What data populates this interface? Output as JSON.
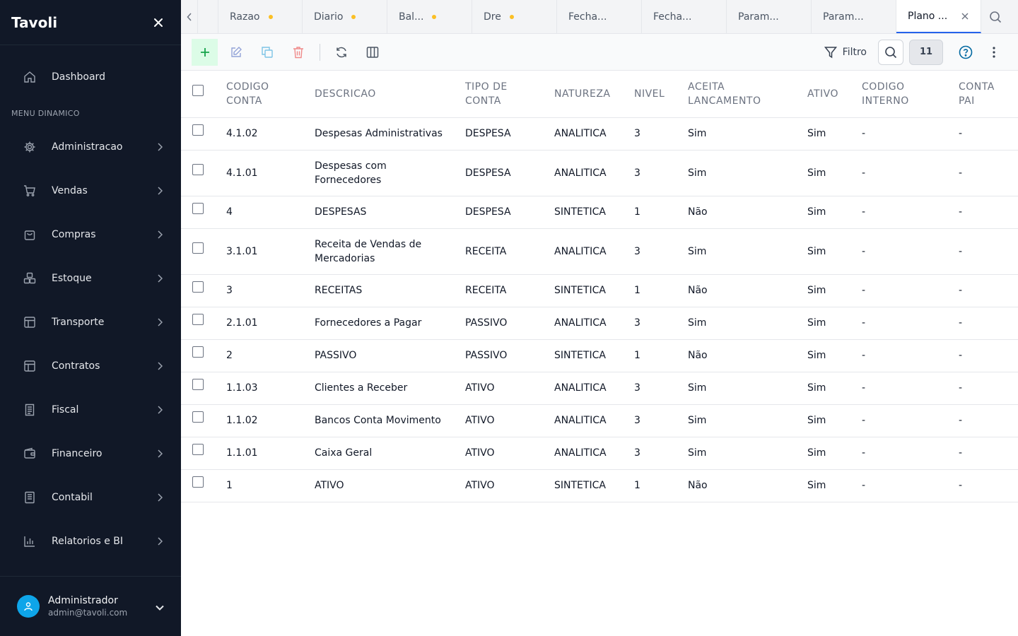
{
  "app": {
    "name": "Tavoli"
  },
  "sidebar": {
    "dashboard_label": "Dashboard",
    "section_title": "MENU DINAMICO",
    "items": [
      {
        "label": "Administracao",
        "icon": "gear-icon"
      },
      {
        "label": "Vendas",
        "icon": "cart-icon"
      },
      {
        "label": "Compras",
        "icon": "shopping-bag-icon"
      },
      {
        "label": "Estoque",
        "icon": "boxes-icon"
      },
      {
        "label": "Transporte",
        "icon": "layout-icon"
      },
      {
        "label": "Contratos",
        "icon": "layout-icon"
      },
      {
        "label": "Fiscal",
        "icon": "receipt-icon"
      },
      {
        "label": "Financeiro",
        "icon": "wallet-icon"
      },
      {
        "label": "Contabil",
        "icon": "ledger-icon"
      },
      {
        "label": "Relatorios e BI",
        "icon": "bar-chart-icon"
      }
    ],
    "user": {
      "name": "Administrador",
      "email": "admin@tavoli.com"
    }
  },
  "tabs": [
    {
      "label": "Razao",
      "unsaved": true
    },
    {
      "label": "Diario",
      "unsaved": true
    },
    {
      "label": "Bal...",
      "unsaved": true
    },
    {
      "label": "Dre",
      "unsaved": true
    },
    {
      "label": "Fecha...",
      "unsaved": false
    },
    {
      "label": "Fecha...",
      "unsaved": false
    },
    {
      "label": "Param...",
      "unsaved": false
    },
    {
      "label": "Param...",
      "unsaved": false
    },
    {
      "label": "Plano ...",
      "unsaved": false,
      "active": true
    }
  ],
  "toolbar": {
    "filter_label": "Filtro",
    "record_count": "11"
  },
  "table": {
    "headers": {
      "codigo_conta": "CODIGO CONTA",
      "descricao": "DESCRICAO",
      "tipo_conta": "TIPO DE CONTA",
      "natureza": "NATUREZA",
      "nivel": "NIVEL",
      "aceita_lancamento": "ACEITA LANCAMENTO",
      "ativo": "ATIVO",
      "codigo_interno": "CODIGO INTERNO",
      "conta_pai": "CONTA PAI"
    },
    "rows": [
      {
        "codigo": "4.1.02",
        "descricao": "Despesas Administrativas",
        "tipo": "DESPESA",
        "natureza": "ANALITICA",
        "nivel": "3",
        "aceita": "Sim",
        "ativo": "Sim",
        "interno": "-",
        "pai": "-"
      },
      {
        "codigo": "4.1.01",
        "descricao": "Despesas com Fornecedores",
        "tipo": "DESPESA",
        "natureza": "ANALITICA",
        "nivel": "3",
        "aceita": "Sim",
        "ativo": "Sim",
        "interno": "-",
        "pai": "-"
      },
      {
        "codigo": "4",
        "descricao": "DESPESAS",
        "tipo": "DESPESA",
        "natureza": "SINTETICA",
        "nivel": "1",
        "aceita": "Não",
        "ativo": "Sim",
        "interno": "-",
        "pai": "-"
      },
      {
        "codigo": "3.1.01",
        "descricao": "Receita de Vendas de Mercadorias",
        "tipo": "RECEITA",
        "natureza": "ANALITICA",
        "nivel": "3",
        "aceita": "Sim",
        "ativo": "Sim",
        "interno": "-",
        "pai": "-"
      },
      {
        "codigo": "3",
        "descricao": "RECEITAS",
        "tipo": "RECEITA",
        "natureza": "SINTETICA",
        "nivel": "1",
        "aceita": "Não",
        "ativo": "Sim",
        "interno": "-",
        "pai": "-"
      },
      {
        "codigo": "2.1.01",
        "descricao": "Fornecedores a Pagar",
        "tipo": "PASSIVO",
        "natureza": "ANALITICA",
        "nivel": "3",
        "aceita": "Sim",
        "ativo": "Sim",
        "interno": "-",
        "pai": "-"
      },
      {
        "codigo": "2",
        "descricao": "PASSIVO",
        "tipo": "PASSIVO",
        "natureza": "SINTETICA",
        "nivel": "1",
        "aceita": "Não",
        "ativo": "Sim",
        "interno": "-",
        "pai": "-"
      },
      {
        "codigo": "1.1.03",
        "descricao": "Clientes a Receber",
        "tipo": "ATIVO",
        "natureza": "ANALITICA",
        "nivel": "3",
        "aceita": "Sim",
        "ativo": "Sim",
        "interno": "-",
        "pai": "-"
      },
      {
        "codigo": "1.1.02",
        "descricao": "Bancos Conta Movimento",
        "tipo": "ATIVO",
        "natureza": "ANALITICA",
        "nivel": "3",
        "aceita": "Sim",
        "ativo": "Sim",
        "interno": "-",
        "pai": "-"
      },
      {
        "codigo": "1.1.01",
        "descricao": "Caixa Geral",
        "tipo": "ATIVO",
        "natureza": "ANALITICA",
        "nivel": "3",
        "aceita": "Sim",
        "ativo": "Sim",
        "interno": "-",
        "pai": "-"
      },
      {
        "codigo": "1",
        "descricao": "ATIVO",
        "tipo": "ATIVO",
        "natureza": "SINTETICA",
        "nivel": "1",
        "aceita": "Não",
        "ativo": "Sim",
        "interno": "-",
        "pai": "-"
      }
    ]
  },
  "colors": {
    "sidebar_bg": "#111827",
    "accent": "#2563eb",
    "add_button": "#16a34a",
    "delete_button": "#ef4444",
    "unsaved_dot": "#fbbf24",
    "avatar": "#0ea5e9"
  }
}
